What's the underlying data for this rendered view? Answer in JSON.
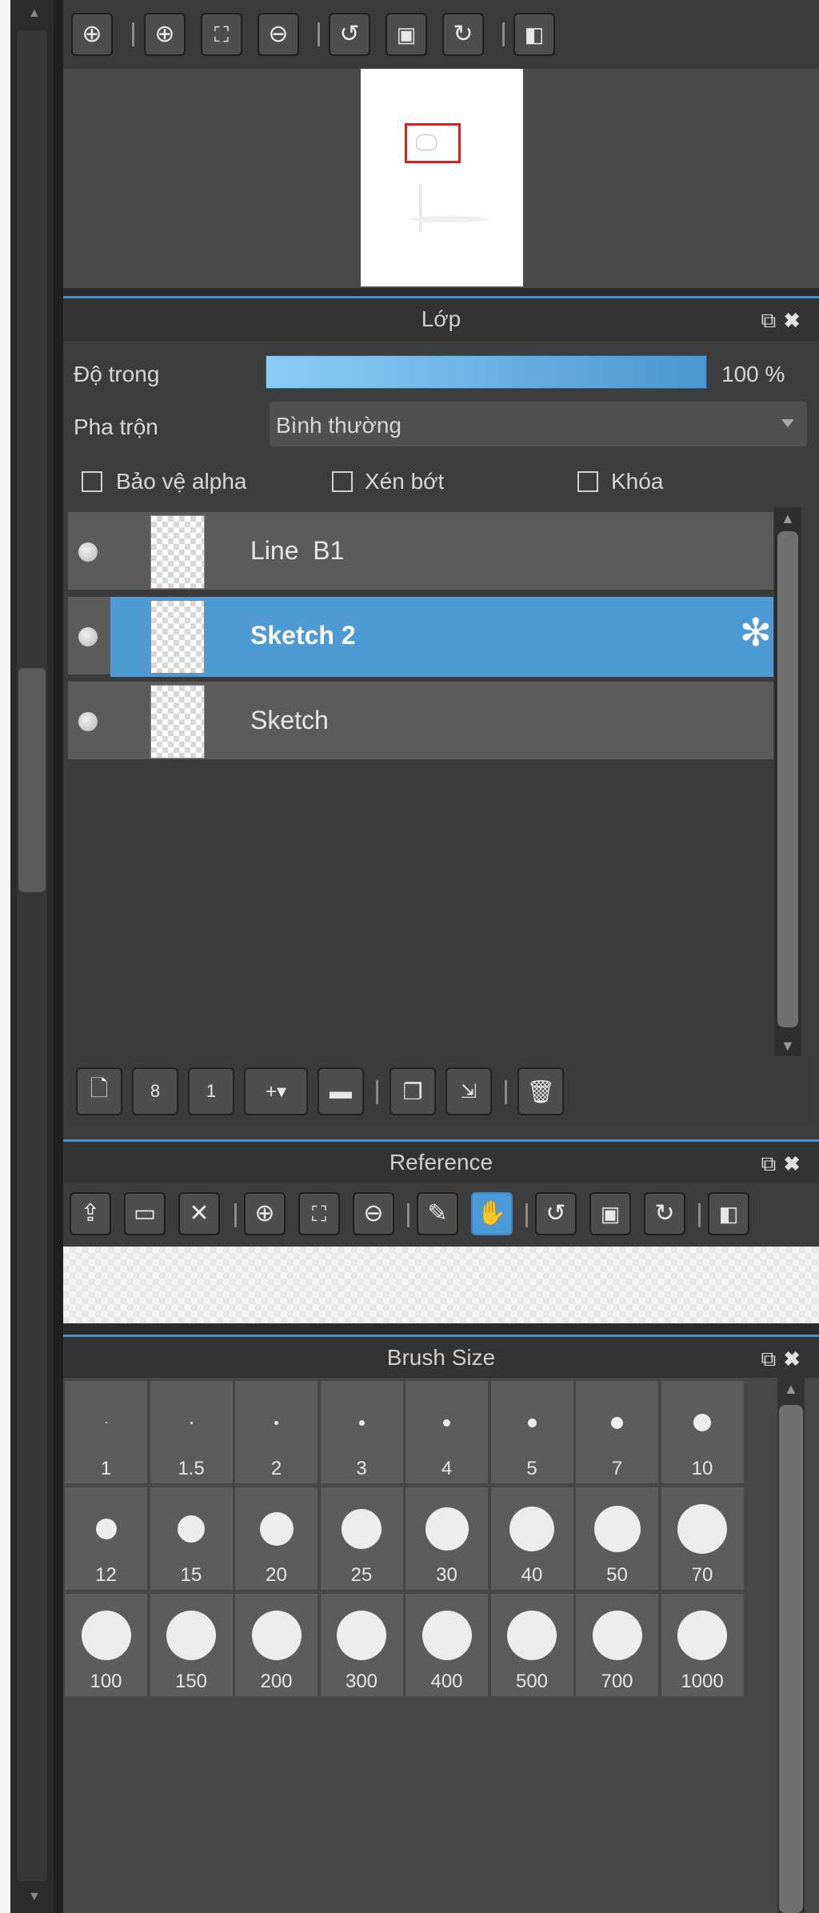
{
  "navigator": {
    "toolbar": [
      "zoom-fit-icon",
      "zoom-in-icon",
      "fit-screen-icon",
      "zoom-out-icon",
      "rotate-left-icon",
      "reset-view-icon",
      "rotate-right-icon",
      "flip-icon"
    ]
  },
  "layer_panel": {
    "title": "Lớp",
    "opacity_label": "Độ trong",
    "opacity_value": "100 %",
    "opacity_fraction": 1.0,
    "blend_label": "Pha trộn",
    "blend_value": "Bình thường",
    "checkboxes": [
      {
        "label": "Bảo vệ alpha",
        "checked": false
      },
      {
        "label": "Xén bớt",
        "checked": false
      },
      {
        "label": "Khóa",
        "checked": false
      }
    ],
    "layers": [
      {
        "name": "Line  B1",
        "selected": false,
        "visible": true
      },
      {
        "name": "Sketch 2",
        "selected": true,
        "visible": true
      },
      {
        "name": "Sketch",
        "selected": false,
        "visible": true
      }
    ],
    "toolbar": [
      "new-layer-icon",
      "new-8bit-layer-icon",
      "new-1bit-layer-icon",
      "add-layer-menu-icon",
      "new-folder-icon",
      "duplicate-layer-icon",
      "merge-down-icon",
      "delete-layer-icon"
    ]
  },
  "reference_panel": {
    "title": "Reference",
    "toolbar": [
      "upload-icon",
      "open-folder-icon",
      "close-icon",
      "zoom-in-icon",
      "fit-screen-icon",
      "zoom-out-icon",
      "eyedropper-icon",
      "hand-icon",
      "rotate-left-icon",
      "reset-view-icon",
      "rotate-right-icon",
      "flip-icon"
    ],
    "active_tool": "hand-icon"
  },
  "brush_panel": {
    "title": "Brush Size",
    "sizes": [
      "1",
      "1.5",
      "2",
      "3",
      "4",
      "5",
      "7",
      "10",
      "12",
      "15",
      "20",
      "25",
      "30",
      "40",
      "50",
      "70",
      "100",
      "150",
      "200",
      "300",
      "400",
      "500",
      "700",
      "1000"
    ]
  },
  "colors": {
    "accent": "#4d9ad5",
    "panel_bg": "#4a4a4a",
    "header_bg": "#333333",
    "navigator_marker": "#d62020"
  }
}
